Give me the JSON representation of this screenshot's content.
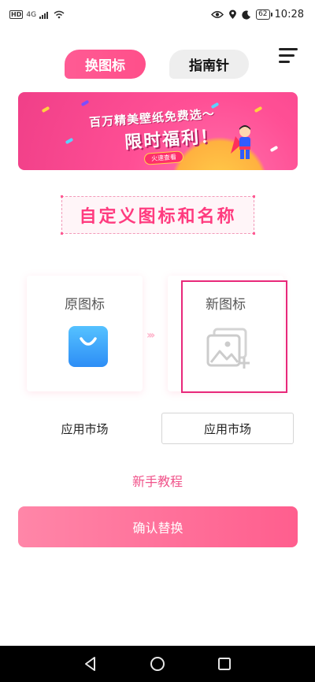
{
  "status_bar": {
    "left_badge": "HD",
    "network": "4G",
    "battery": "62",
    "time": "10:28"
  },
  "tabs": [
    {
      "label": "换图标",
      "active": true
    },
    {
      "label": "指南针",
      "active": false
    }
  ],
  "banner": {
    "line1": "百万精美壁纸免费选～",
    "line2": "限时福利！",
    "button": "火速查看"
  },
  "section_title": "自定义图标和名称",
  "cards": {
    "original_label": "原图标",
    "new_label": "新图标"
  },
  "original_app_name": "应用市场",
  "new_app_name_input": "应用市场",
  "tutorial_link": "新手教程",
  "confirm_button": "确认替换",
  "colors": {
    "accent": "#ff4f8a",
    "selection_border": "#e8287a",
    "app_icon": "#2d8ef6"
  }
}
